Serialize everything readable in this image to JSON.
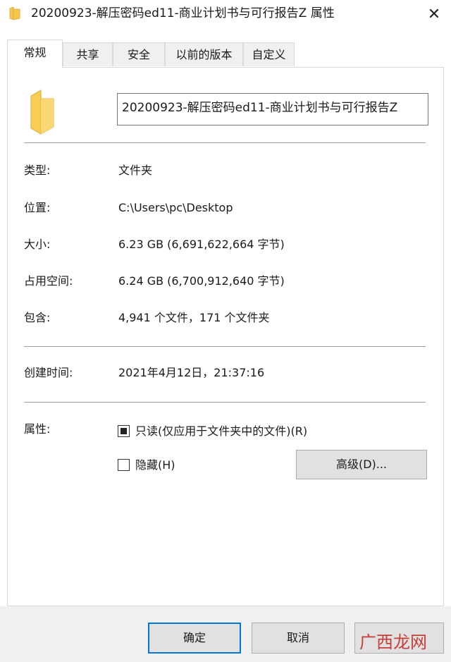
{
  "window": {
    "title": "20200923-解压密码ed11-商业计划书与可行报告Z 属性",
    "close_glyph": "✕",
    "folder_icon": "folder-icon"
  },
  "tabs": [
    {
      "label": "常规",
      "active": true
    },
    {
      "label": "共享",
      "active": false
    },
    {
      "label": "安全",
      "active": false
    },
    {
      "label": "以前的版本",
      "active": false
    },
    {
      "label": "自定义",
      "active": false
    }
  ],
  "general": {
    "name_value": "20200923-解压密码ed11-商业计划书与可行报告Z",
    "type": {
      "label": "类型:",
      "value": "文件夹"
    },
    "location": {
      "label": "位置:",
      "value": "C:\\Users\\pc\\Desktop"
    },
    "size": {
      "label": "大小:",
      "value": "6.23 GB (6,691,622,664 字节)"
    },
    "size_on_disk": {
      "label": "占用空间:",
      "value": "6.24 GB (6,700,912,640 字节)"
    },
    "contains": {
      "label": "包含:",
      "value": "4,941 个文件，171 个文件夹"
    },
    "created": {
      "label": "创建时间:",
      "value": "2021年4月12日，21:37:16"
    },
    "attributes": {
      "label": "属性:",
      "readonly_label": "只读(仅应用于文件夹中的文件)(R)",
      "readonly_state": "indeterminate",
      "hidden_label": "隐藏(H)",
      "hidden_state": "unchecked",
      "advanced_button": "高级(D)..."
    }
  },
  "buttons": {
    "ok": "确定",
    "cancel": "取消"
  },
  "watermark": {
    "text": "广西龙网",
    "color": "#c4312c"
  },
  "colors": {
    "accent": "#0078d7",
    "folder": "#f5c84c"
  }
}
